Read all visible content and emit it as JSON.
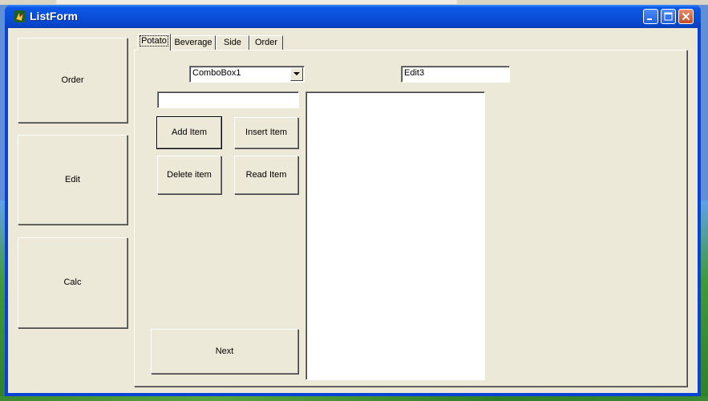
{
  "window": {
    "title": "ListForm",
    "title_bar_color": "#0a4fd9"
  },
  "left_panels": [
    {
      "label": "Order"
    },
    {
      "label": "Edit"
    },
    {
      "label": "Calc"
    }
  ],
  "tabs": [
    {
      "label": "Potato",
      "active": true
    },
    {
      "label": "Beverage",
      "active": false
    },
    {
      "label": "Side",
      "active": false
    },
    {
      "label": "Order",
      "active": false
    }
  ],
  "potato_tab": {
    "combobox_value": "ComboBox1",
    "edit3_value": "Edit3",
    "text_input_value": "",
    "buttons": {
      "add_item": "Add Item",
      "insert_item": "Insert Item",
      "delete_item": "Delete item",
      "read_item": "Read Item",
      "next": "Next"
    },
    "list_items": []
  },
  "icons": {
    "app": "app-icon",
    "minimize": "minimize-icon",
    "maximize": "maximize-icon",
    "close": "close-icon",
    "dropdown": "chevron-down-icon"
  }
}
